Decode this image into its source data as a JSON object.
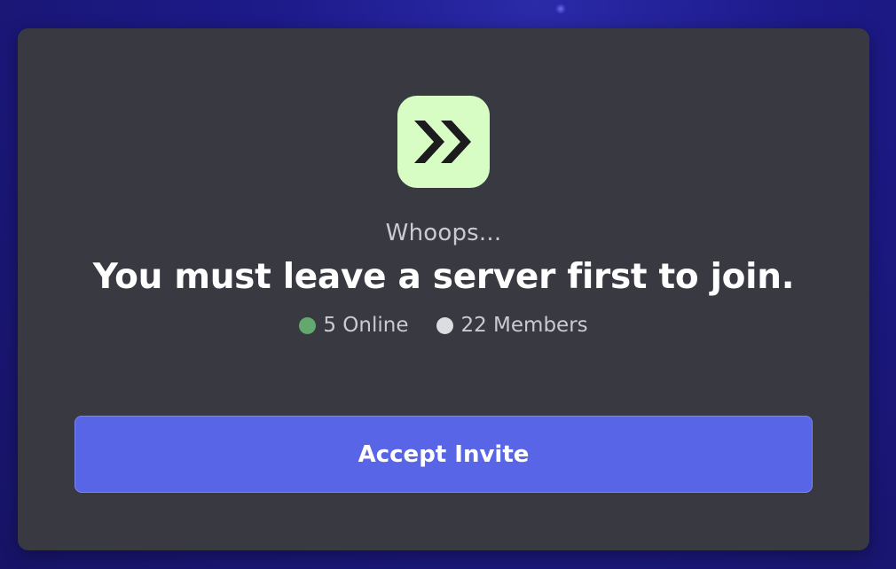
{
  "invite": {
    "server_icon": "double-chevron-right-icon",
    "subtitle": "Whoops...",
    "title": "You must leave a server first to join.",
    "online_text": "5 Online",
    "members_text": "22 Members",
    "accept_label": "Accept Invite"
  },
  "colors": {
    "online_dot": "#63a86e",
    "members_dot": "#dcdde0",
    "icon_bg": "#d7fcc4",
    "button_bg": "#5865e6",
    "card_bg": "#393a41"
  }
}
